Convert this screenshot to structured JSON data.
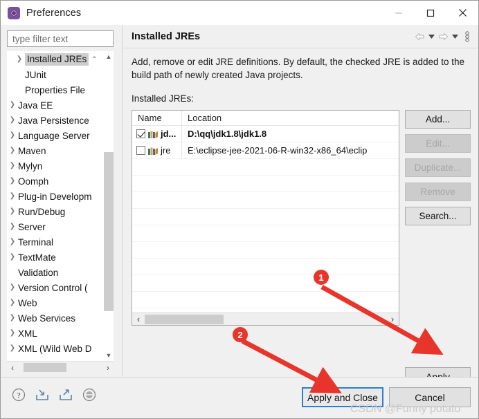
{
  "window": {
    "title": "Preferences",
    "icon": "preferences-icon",
    "controls": {
      "minimize": "minimize-icon",
      "maximize": "maximize-icon",
      "close": "close-icon"
    }
  },
  "sidebar": {
    "filter": {
      "value": "",
      "placeholder": "type filter text"
    },
    "items": [
      {
        "label": "Installed JREs",
        "arrow": true,
        "indent": 1,
        "selected": true
      },
      {
        "label": "JUnit",
        "arrow": false,
        "indent": 1,
        "selected": false
      },
      {
        "label": "Properties File",
        "arrow": false,
        "indent": 1,
        "selected": false
      },
      {
        "label": "Java EE",
        "arrow": true,
        "indent": 0,
        "selected": false
      },
      {
        "label": "Java Persistence",
        "arrow": true,
        "indent": 0,
        "selected": false
      },
      {
        "label": "Language Server",
        "arrow": true,
        "indent": 0,
        "selected": false
      },
      {
        "label": "Maven",
        "arrow": true,
        "indent": 0,
        "selected": false
      },
      {
        "label": "Mylyn",
        "arrow": true,
        "indent": 0,
        "selected": false
      },
      {
        "label": "Oomph",
        "arrow": true,
        "indent": 0,
        "selected": false
      },
      {
        "label": "Plug-in Developm",
        "arrow": true,
        "indent": 0,
        "selected": false
      },
      {
        "label": "Run/Debug",
        "arrow": true,
        "indent": 0,
        "selected": false
      },
      {
        "label": "Server",
        "arrow": true,
        "indent": 0,
        "selected": false
      },
      {
        "label": "Terminal",
        "arrow": true,
        "indent": 0,
        "selected": false
      },
      {
        "label": "TextMate",
        "arrow": true,
        "indent": 0,
        "selected": false
      },
      {
        "label": "Validation",
        "arrow": false,
        "indent": 0,
        "selected": false
      },
      {
        "label": "Version Control (",
        "arrow": true,
        "indent": 0,
        "selected": false
      },
      {
        "label": "Web",
        "arrow": true,
        "indent": 0,
        "selected": false
      },
      {
        "label": "Web Services",
        "arrow": true,
        "indent": 0,
        "selected": false
      },
      {
        "label": "XML",
        "arrow": true,
        "indent": 0,
        "selected": false
      },
      {
        "label": "XML (Wild Web D",
        "arrow": true,
        "indent": 0,
        "selected": false
      }
    ]
  },
  "page": {
    "title": "Installed JREs",
    "toolbar": {
      "back": "back-arrow-icon",
      "back_menu": "chevron-down-icon",
      "forward": "forward-arrow-icon",
      "forward_menu": "chevron-down-icon",
      "view_menu": "view-menu-icon"
    },
    "description": "Add, remove or edit JRE definitions. By default, the checked JRE is added to the build path of newly created Java projects.",
    "list_label": "Installed JREs:",
    "table": {
      "columns": [
        "Name",
        "Location"
      ],
      "rows": [
        {
          "checked": true,
          "name": "jd...",
          "location": "D:\\qq\\jdk1.8\\jdk1.8",
          "bold": true
        },
        {
          "checked": false,
          "name": "jre",
          "location": "E:\\eclipse-jee-2021-06-R-win32-x86_64\\eclip",
          "bold": false
        }
      ]
    },
    "side_buttons": [
      {
        "label": "Add...",
        "enabled": true
      },
      {
        "label": "Edit...",
        "enabled": false
      },
      {
        "label": "Duplicate...",
        "enabled": false
      },
      {
        "label": "Remove",
        "enabled": false
      },
      {
        "label": "Search...",
        "enabled": true
      }
    ],
    "apply_label": "Apply"
  },
  "footer": {
    "icons": [
      {
        "name": "help-icon"
      },
      {
        "name": "import-icon"
      },
      {
        "name": "export-icon"
      },
      {
        "name": "restore-defaults-icon"
      }
    ],
    "buttons": [
      {
        "label": "Apply and Close",
        "focused": true
      },
      {
        "label": "Cancel",
        "focused": false
      }
    ]
  },
  "annotations": {
    "markers": [
      {
        "id": "1",
        "label": "1",
        "target": "Apply"
      },
      {
        "id": "2",
        "label": "2",
        "target": "Apply and Close"
      }
    ],
    "color": "#e8352c"
  },
  "watermark": "CSDN @Funny potato"
}
